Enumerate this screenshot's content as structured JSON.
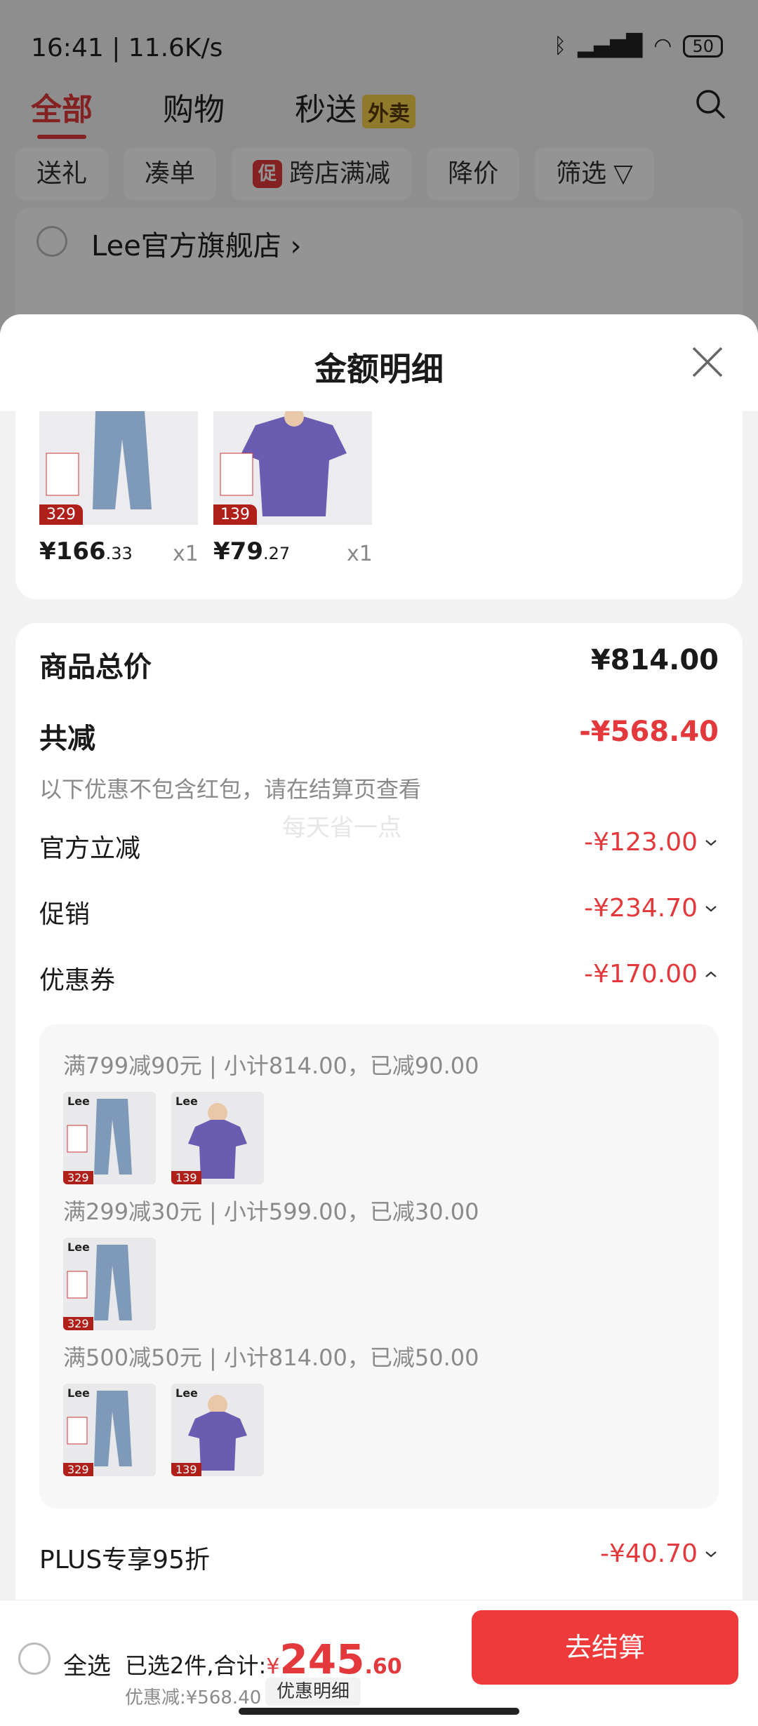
{
  "status_bar": {
    "time": "16:41 | 11.6K/s",
    "battery": "50"
  },
  "top_tabs": {
    "all": "全部",
    "shopping": "购物",
    "express": "秒送",
    "express_badge": "外卖"
  },
  "filters": [
    "送礼",
    "凑单",
    "跨店满减",
    "降价",
    "筛选"
  ],
  "filters_promo_badge": "促",
  "store": {
    "name": "Lee官方旗舰店"
  },
  "sheet": {
    "title": "金额明细",
    "products": [
      {
        "price_int": "¥166",
        "price_dec": ".33",
        "qty": "x1",
        "tag": "329"
      },
      {
        "price_int": "¥79",
        "price_dec": ".27",
        "qty": "x1",
        "tag": "139"
      }
    ],
    "summary": {
      "total_label": "商品总价",
      "total_value": "¥814.00",
      "reduce_label": "共减",
      "reduce_value": "-¥568.40",
      "note": "以下优惠不包含红包，请在结算页查看",
      "watermark": "每天省一点",
      "official_label": "官方立减",
      "official_value": "-¥123.00",
      "promo_label": "促销",
      "promo_value": "-¥234.70",
      "coupon_label": "优惠券",
      "coupon_value": "-¥170.00",
      "plus_label": "PLUS专享95折",
      "plus_value": "-¥40.70"
    },
    "coupons": [
      {
        "title": "满799减90元 | 小计814.00，已减90.00",
        "items": [
          "329",
          "139"
        ]
      },
      {
        "title": "满299减30元 | 小计599.00，已减30.00",
        "items": [
          "329"
        ]
      },
      {
        "title": "满500减50元 | 小计814.00，已减50.00",
        "items": [
          "329",
          "139"
        ]
      }
    ],
    "thumb_brand": "Lee"
  },
  "footer": {
    "select_all": "全选",
    "selected_text": "已选2件,合计:",
    "currency": "¥",
    "total_int": "245",
    "total_dec": ".60",
    "discount_text": "优惠减:¥568.40",
    "detail_button": "优惠明细",
    "checkout_button": "去结算"
  },
  "colors": {
    "accent": "#e4393c",
    "checkout": "#ef3a3b"
  }
}
